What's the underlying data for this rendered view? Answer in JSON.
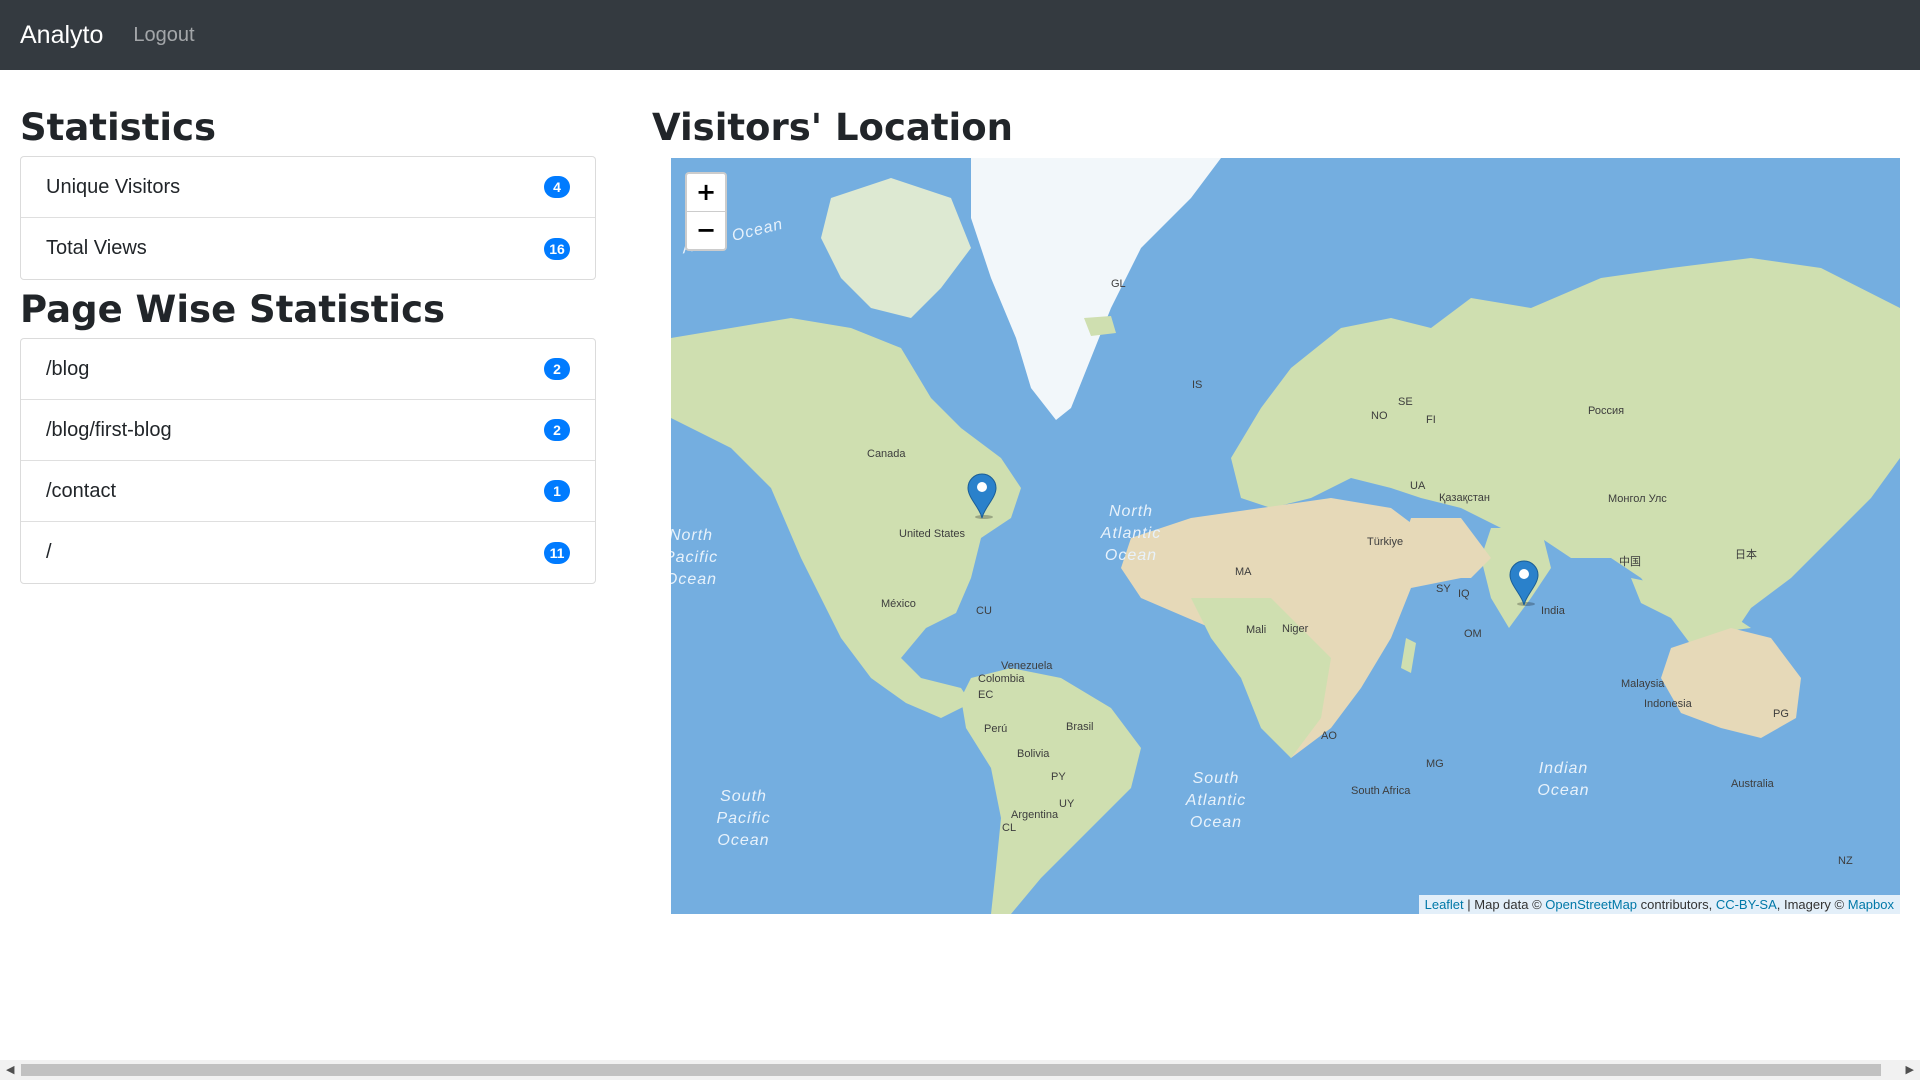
{
  "navbar": {
    "brand": "Analyto",
    "logout": "Logout"
  },
  "statistics": {
    "title": "Statistics",
    "items": [
      {
        "label": "Unique Visitors",
        "count": "4"
      },
      {
        "label": "Total Views",
        "count": "16"
      }
    ]
  },
  "page_wise": {
    "title": "Page Wise Statistics",
    "items": [
      {
        "label": "/blog",
        "count": "2"
      },
      {
        "label": "/blog/first-blog",
        "count": "2"
      },
      {
        "label": "/contact",
        "count": "1"
      },
      {
        "label": "/",
        "count": "11"
      }
    ]
  },
  "map": {
    "title": "Visitors' Location",
    "zoom_in": "+",
    "zoom_out": "−",
    "markers": [
      "united-states",
      "india"
    ],
    "labels": {
      "canada": "Canada",
      "usa": "United States",
      "mexico": "México",
      "cu": "CU",
      "venezuela": "Venezuela",
      "colombia": "Colombia",
      "ec": "EC",
      "peru": "Perú",
      "brasil": "Brasil",
      "bolivia": "Bolivia",
      "py": "PY",
      "uy": "UY",
      "cl": "CL",
      "argentina": "Argentina",
      "gl": "GL",
      "is": "IS",
      "russia": "Россия",
      "kazakhstan": "Қазақстан",
      "mongolia": "Монгол Улс",
      "china": "中国",
      "japan": "日本",
      "india": "India",
      "australia": "Australia",
      "ma": "MA",
      "niger": "Niger",
      "mali": "Mali",
      "ao": "AO",
      "south_africa": "South Africa",
      "mg": "MG",
      "sy": "SY",
      "iq": "IQ",
      "om": "OM",
      "malaysia": "Malaysia",
      "indonesia": "Indonesia",
      "pg": "PG",
      "nz": "NZ",
      "turkiye": "Türkiye",
      "ua": "UA",
      "fi": "FI",
      "se": "SE",
      "no": "NO"
    },
    "oceans": {
      "arctic": "Arctic Ocean",
      "north_atlantic": "North Atlantic Ocean",
      "south_pacific": "South Pacific Ocean",
      "south_atlantic": "South Atlantic Ocean",
      "indian": "Indian Ocean",
      "north_pacific_partial": "North Pacific Ocean"
    },
    "attribution": {
      "leaflet": "Leaflet",
      "map_data": " | Map data © ",
      "osm": "OpenStreetMap",
      "contributors": " contributors, ",
      "license": "CC-BY-SA",
      "imagery": ", Imagery © ",
      "mapbox": "Mapbox"
    },
    "colors": {
      "water": "#74aee0",
      "land": "#cfdfb0",
      "ice": "#f2f7fa",
      "marker": "#2a81cb"
    }
  }
}
